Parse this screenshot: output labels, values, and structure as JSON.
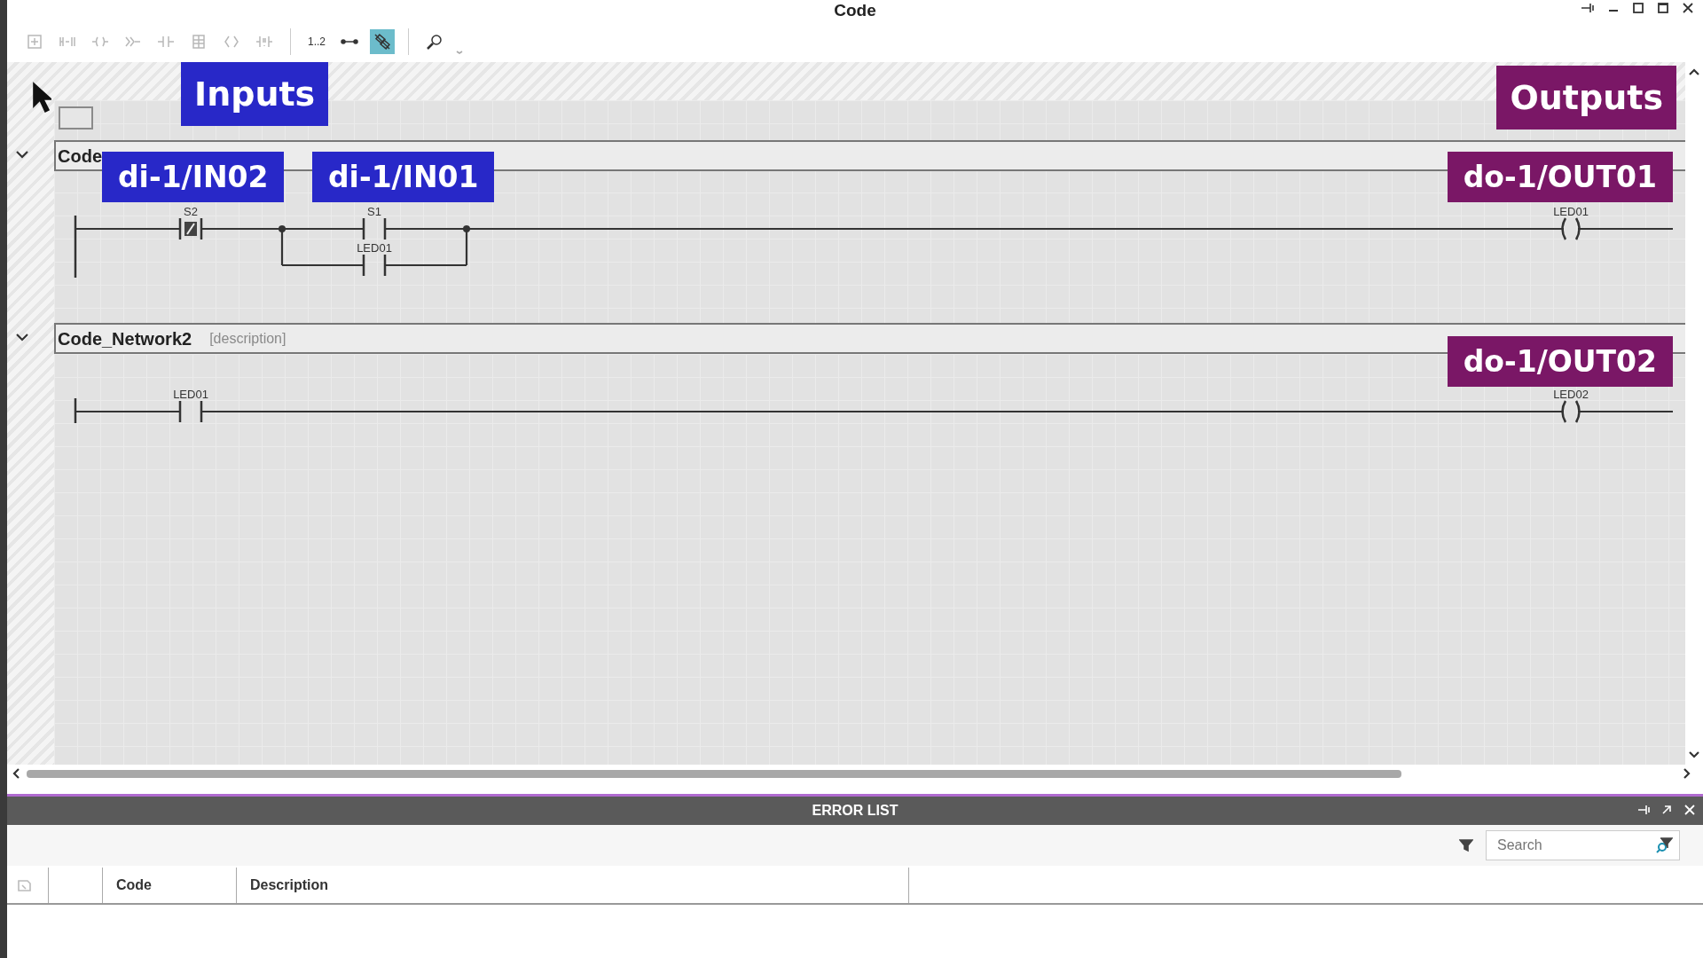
{
  "window": {
    "title": "Code"
  },
  "toolbar": [
    {
      "kind": "icon",
      "disabled": true,
      "selected": false
    },
    {
      "kind": "icon",
      "disabled": true,
      "selected": false
    },
    {
      "kind": "icon",
      "disabled": true,
      "selected": false
    },
    {
      "kind": "icon",
      "disabled": true,
      "selected": false
    },
    {
      "kind": "icon",
      "disabled": true,
      "selected": false
    },
    {
      "kind": "icon",
      "disabled": true,
      "selected": false
    },
    {
      "kind": "icon",
      "disabled": true,
      "selected": false
    },
    {
      "kind": "icon",
      "disabled": true,
      "selected": false
    },
    {
      "kind": "separator"
    },
    {
      "kind": "text",
      "label": "1..2",
      "disabled": false,
      "selected": false
    },
    {
      "kind": "icon",
      "disabled": false,
      "selected": false
    },
    {
      "kind": "icon",
      "disabled": false,
      "selected": true
    },
    {
      "kind": "separator"
    },
    {
      "kind": "icon",
      "disabled": false,
      "selected": false
    }
  ],
  "legend": [
    {
      "text": "Inputs",
      "color": "#2828c8"
    },
    {
      "text": "Outputs",
      "color": "#7a1766"
    }
  ],
  "networks": [
    {
      "name": "Code",
      "expanded": true,
      "elements": [
        {
          "kind": "contact_nc",
          "label": "S2",
          "tag": "di-1/IN02"
        },
        {
          "kind": "branch",
          "children": [
            {
              "kind": "contact_no",
              "label": "S1",
              "tag": "di-1/IN01"
            },
            {
              "kind": "contact_no",
              "label": "LED01"
            }
          ]
        },
        {
          "kind": "coil",
          "label": "LED01",
          "tag": "do-1/OUT01"
        }
      ]
    },
    {
      "name": "Code_Network2",
      "description": "[description]",
      "expanded": true,
      "elements": [
        {
          "kind": "contact_no",
          "label": "LED01"
        },
        {
          "kind": "coil",
          "label": "LED02",
          "tag": "do-1/OUT02"
        }
      ]
    }
  ],
  "error_list": {
    "title": "ERROR LIST",
    "search": {
      "placeholder": "Search"
    },
    "columns": [
      "Code",
      "Description"
    ]
  }
}
